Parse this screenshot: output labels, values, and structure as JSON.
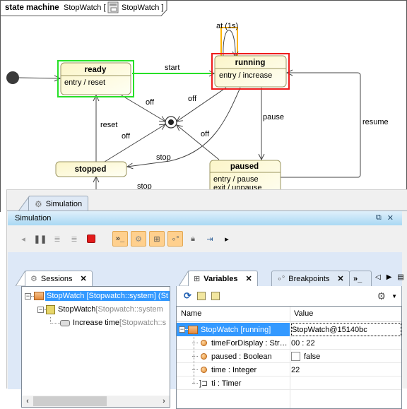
{
  "diagram": {
    "frame_keyword": "state machine",
    "frame_name": "StopWatch [",
    "frame_context": "StopWatch ]",
    "frame_icon": "class-icon",
    "states": [
      {
        "id": "ready",
        "name": "ready",
        "behaviors": [
          "entry / reset"
        ],
        "highlight": "#27e027"
      },
      {
        "id": "running",
        "name": "running",
        "behaviors": [
          "entry / increase"
        ],
        "highlight": "#ee1c1c"
      },
      {
        "id": "stopped",
        "name": "stopped",
        "behaviors": []
      },
      {
        "id": "paused",
        "name": "paused",
        "behaviors": [
          "entry / pause",
          "exit / unpause"
        ]
      }
    ],
    "transitions": {
      "start": "start",
      "self": "at (1s)",
      "pause": "pause",
      "resume": "resume",
      "reset": "reset",
      "stop_running": "stop",
      "stop_paused": "stop",
      "off_ready": "off",
      "off_running": "off",
      "off_stopped": "off",
      "off_paused": "off"
    },
    "colors": {
      "active_transition": "#27e027",
      "active_state_border": "#ee1c1c",
      "self_transition_highlight": "#ffb500",
      "state_fill": "#fffbdc"
    }
  },
  "simulation": {
    "outer_tab_label": "Simulation",
    "title": "Simulation",
    "title_icons": [
      "restore-icon",
      "close-icon"
    ],
    "toolbar": [
      {
        "name": "scroll-left-icon",
        "glyph": "◂",
        "on": false
      },
      {
        "name": "pause-icon",
        "glyph": "❚❚",
        "on": false
      },
      {
        "name": "step-into-icon",
        "glyph": "≡",
        "on": false
      },
      {
        "name": "step-over-icon",
        "glyph": "≡",
        "on": false
      },
      {
        "name": "terminate-icon",
        "glyph": "■",
        "on": false
      },
      {
        "name": "console-icon",
        "glyph": "»_",
        "on": true
      },
      {
        "name": "sessions-gear-icon",
        "glyph": "⚙",
        "on": true
      },
      {
        "name": "variables-tree-icon",
        "glyph": "⊞",
        "on": true
      },
      {
        "name": "breakpoints-icon",
        "glyph": "∘°",
        "on": true
      },
      {
        "name": "lock-icon",
        "glyph": "🔒",
        "on": false
      },
      {
        "name": "export-icon",
        "glyph": "⇥",
        "on": false
      },
      {
        "name": "scroll-right-icon",
        "glyph": "▸",
        "on": false
      }
    ],
    "sessions": {
      "tab_label": "Sessions",
      "tree": [
        {
          "label": "StopWatch [Stopwatch::system] (St",
          "gray": "",
          "selected": true,
          "level": 0
        },
        {
          "label": "StopWatch ",
          "gray": "[Stopwatch::system",
          "selected": false,
          "level": 1
        },
        {
          "label": "Increase time ",
          "gray": "[Stopwatch::s",
          "selected": false,
          "level": 2
        }
      ]
    },
    "variables": {
      "tabs": [
        {
          "label": "Variables",
          "active": true
        },
        {
          "label": "Breakpoints",
          "active": false
        },
        {
          "label": "",
          "active": false
        }
      ],
      "columns": [
        "Name",
        "Value"
      ],
      "rows": [
        {
          "name": "StopWatch [running]",
          "value": "StopWatch@15140bc",
          "kind": "object",
          "selected": true
        },
        {
          "name": "timeForDisplay : Str…",
          "value": "00 : 22",
          "kind": "property"
        },
        {
          "name": "paused : Boolean",
          "value": "false",
          "kind": "boolean",
          "checked": false
        },
        {
          "name": "time : Integer",
          "value": "22",
          "kind": "property"
        },
        {
          "name": "ti : Timer",
          "value": "",
          "kind": "port"
        }
      ]
    }
  }
}
